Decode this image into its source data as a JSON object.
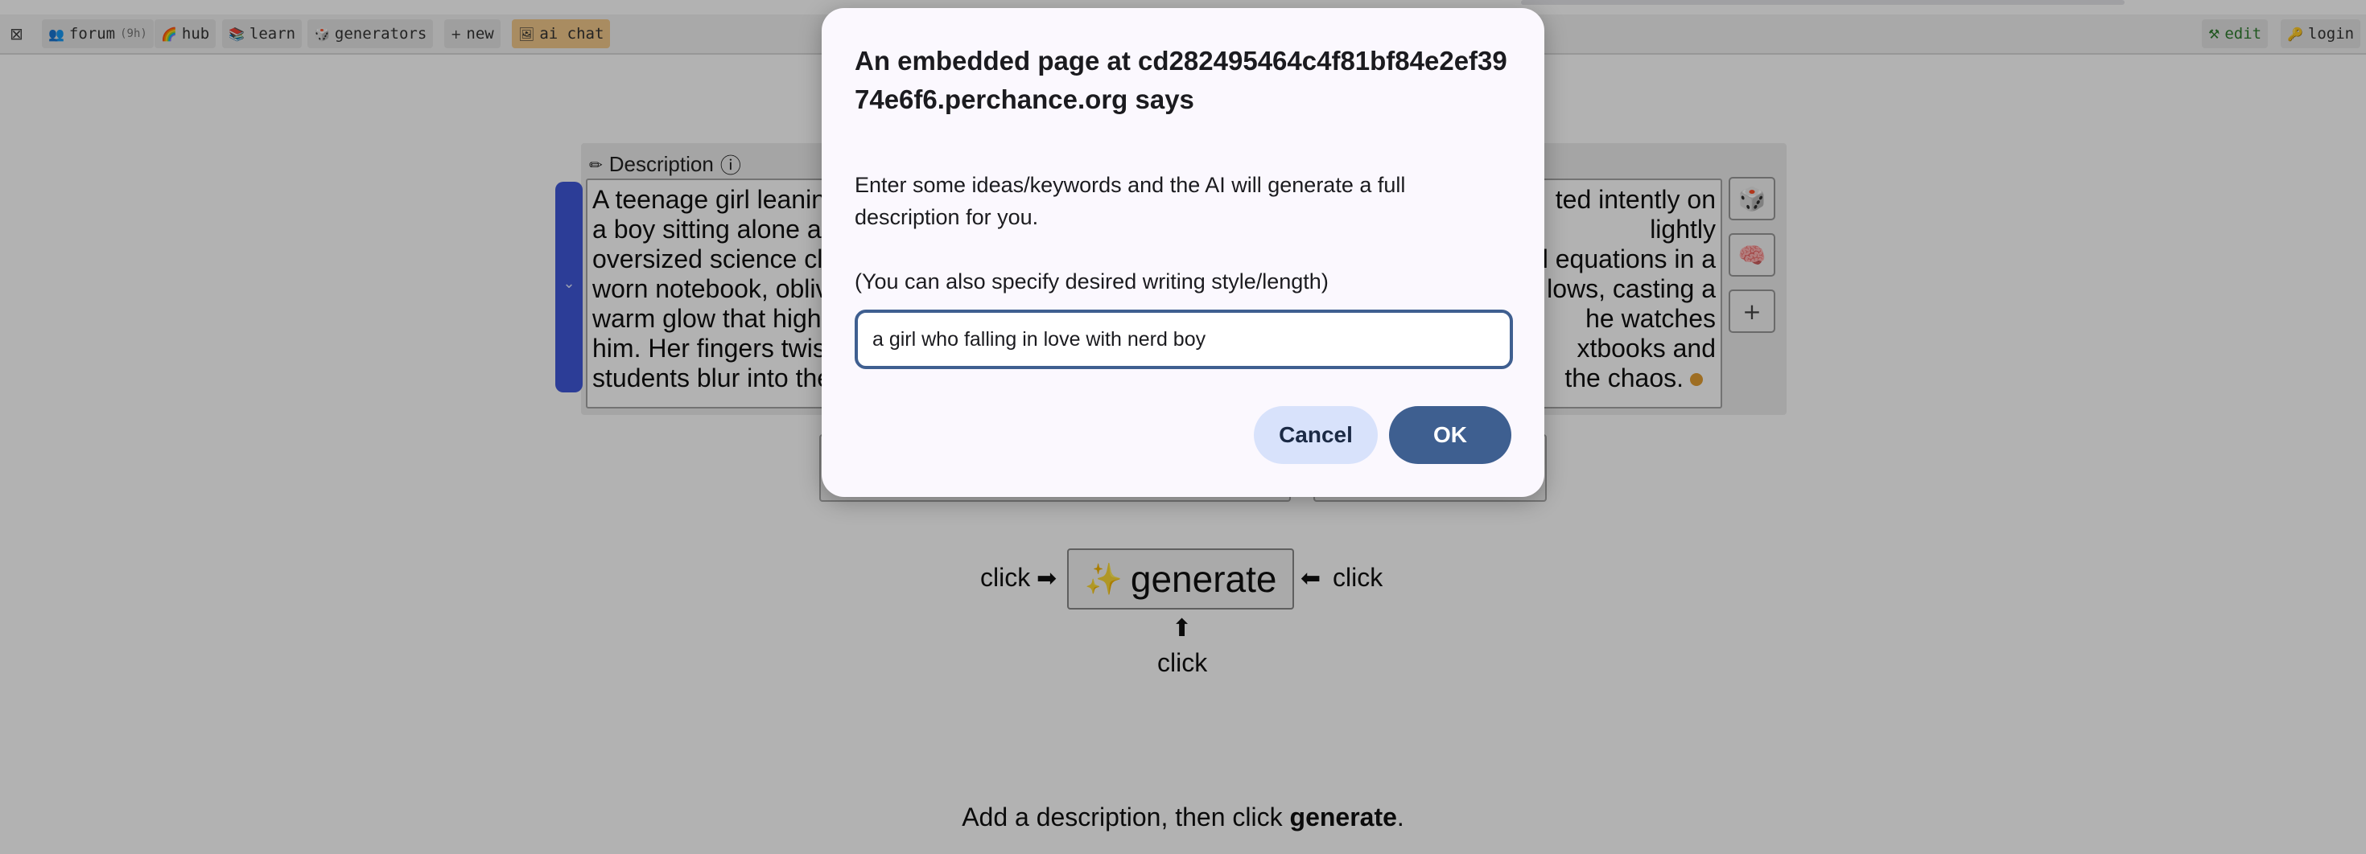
{
  "nav": {
    "close_icon": "⊠",
    "items": [
      {
        "icon": "👥",
        "label": "forum",
        "badge": "(9h)"
      },
      {
        "icon": "🌈",
        "label": "hub"
      },
      {
        "icon": "📚",
        "label": "learn"
      },
      {
        "icon": "🎲",
        "label": "generators"
      },
      {
        "icon": "+",
        "label": "new"
      },
      {
        "icon": "🖼",
        "label": "ai chat"
      }
    ],
    "edit": {
      "icon": "⚒",
      "label": "edit"
    },
    "login": {
      "icon": "🔑",
      "label": "login"
    }
  },
  "description": {
    "label": "Description",
    "info_icon": "ⓘ",
    "pencil_icon": "✏",
    "collapse_icon": "⌄",
    "left_lines": [
      "A teenage girl leanin",
      "a boy sitting alone at",
      "oversized science cl",
      "worn notebook, obliv",
      "warm glow that highl",
      "him. Her fingers twis",
      "students blur into the"
    ],
    "right_lines": [
      "ted intently on",
      "lightly",
      "l equations in a",
      "lows, casting a",
      "he watches",
      "xtbooks and",
      "the chaos."
    ],
    "side_buttons": [
      "🎲",
      "🧠",
      "+"
    ]
  },
  "generate": {
    "label": "generate",
    "sparkle": "✨",
    "click_left": "click",
    "click_right": "click",
    "click_below": "click",
    "arrow_left": "➡",
    "arrow_right": "⬅",
    "arrow_up": "⬆"
  },
  "status": {
    "prefix": "Add a description, then click ",
    "bold": "generate",
    "suffix": "."
  },
  "dialog": {
    "title": "An embedded page at cd282495464c4f81bf84e2ef3974e6f6.perchance.org says",
    "message": "Enter some ideas/keywords and the AI will generate a full description for you.",
    "hint": "(You can also specify desired writing style/length)",
    "input_value": "a girl who falling in love with nerd boy",
    "cancel_label": "Cancel",
    "ok_label": "OK"
  }
}
